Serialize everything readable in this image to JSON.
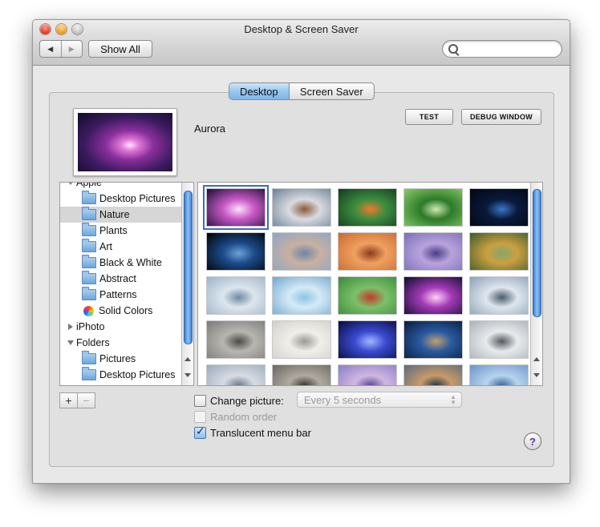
{
  "window": {
    "title": "Desktop & Screen Saver",
    "show_all_label": "Show All",
    "nav_back": "◀",
    "nav_forward": "▶",
    "search_placeholder": ""
  },
  "tabs": [
    {
      "label": "Desktop",
      "selected": true
    },
    {
      "label": "Screen Saver",
      "selected": false
    }
  ],
  "preview": {
    "picture_name": "Aurora",
    "test_label": "TEST",
    "debug_label": "DEBUG WINDOW"
  },
  "source_list": {
    "items": [
      {
        "label": "Apple",
        "kind": "group",
        "expanded": true
      },
      {
        "label": "Desktop Pictures",
        "kind": "folder"
      },
      {
        "label": "Nature",
        "kind": "folder",
        "selected": true
      },
      {
        "label": "Plants",
        "kind": "folder"
      },
      {
        "label": "Art",
        "kind": "folder"
      },
      {
        "label": "Black & White",
        "kind": "folder"
      },
      {
        "label": "Abstract",
        "kind": "folder"
      },
      {
        "label": "Patterns",
        "kind": "folder"
      },
      {
        "label": "Solid Colors",
        "kind": "colors"
      },
      {
        "label": "iPhoto",
        "kind": "group",
        "expanded": false
      },
      {
        "label": "Folders",
        "kind": "group",
        "expanded": true
      },
      {
        "label": "Pictures",
        "kind": "folder"
      },
      {
        "label": "Desktop Pictures",
        "kind": "folder"
      }
    ],
    "add_label": "+",
    "remove_label": "−"
  },
  "thumbnails": [
    {
      "subject": "aurora purple",
      "selected": true,
      "colors": [
        "#1a0c33",
        "#c85ac6",
        "#ffe0ff"
      ]
    },
    {
      "subject": "mountain peaks",
      "colors": [
        "#6a7e96",
        "#d9dbe0",
        "#8b5a3a"
      ]
    },
    {
      "subject": "clownfish anemone",
      "colors": [
        "#123a1e",
        "#3d8d3f",
        "#f07a2a"
      ]
    },
    {
      "subject": "dew drop leaf",
      "colors": [
        "#8acb6a",
        "#2d7a2a",
        "#cfe9b0"
      ]
    },
    {
      "subject": "earth horizon",
      "colors": [
        "#020510",
        "#0a1a3c",
        "#3a78c8"
      ]
    },
    {
      "subject": "earth globe",
      "colors": [
        "#000000",
        "#1c4c8c",
        "#6fa2d8"
      ]
    },
    {
      "subject": "misty sea",
      "colors": [
        "#8aa6c8",
        "#c8b0a0",
        "#6c86a8"
      ]
    },
    {
      "subject": "sandstone waves",
      "colors": [
        "#c76a2e",
        "#f0a060",
        "#8c3a1a"
      ]
    },
    {
      "subject": "purple dunes",
      "colors": [
        "#7a6cb8",
        "#b8a4dc",
        "#4a3c88"
      ]
    },
    {
      "subject": "golden pavilion",
      "colors": [
        "#3a5a2a",
        "#caa040",
        "#86a66a"
      ]
    },
    {
      "subject": "calm water",
      "colors": [
        "#9ab4c8",
        "#dde6ee",
        "#6f8aa0"
      ]
    },
    {
      "subject": "ice crystals",
      "colors": [
        "#6fa8d0",
        "#d6eaf6",
        "#8cc4e6"
      ]
    },
    {
      "subject": "ladybug leaf",
      "colors": [
        "#3a8a3a",
        "#7cc06a",
        "#c43a2a"
      ]
    },
    {
      "subject": "aurora",
      "colors": [
        "#0a0c2a",
        "#a43ab8",
        "#ffd0f6"
      ]
    },
    {
      "subject": "misty trees",
      "colors": [
        "#8aa0b8",
        "#dfe6ee",
        "#4a5a6c"
      ]
    },
    {
      "subject": "zen garden",
      "colors": [
        "#7a7a78",
        "#b8b6b0",
        "#4a4a48"
      ]
    },
    {
      "subject": "pebbles",
      "colors": [
        "#d0cfcb",
        "#f0efe9",
        "#9a9994"
      ]
    },
    {
      "subject": "blue aurora",
      "colors": [
        "#050a3a",
        "#3a4ad0",
        "#a0b8ff"
      ]
    },
    {
      "subject": "snow leopard rock",
      "colors": [
        "#0a1a3a",
        "#2a5aa0",
        "#c0a070"
      ]
    },
    {
      "subject": "snow leopard",
      "colors": [
        "#a8b0b8",
        "#e8eaec",
        "#555a60"
      ]
    },
    {
      "subject": "sand ripples",
      "colors": [
        "#9aaabb",
        "#d8dce4",
        "#6c7a8c"
      ]
    },
    {
      "subject": "beach stones",
      "colors": [
        "#6a6660",
        "#b0aaa0",
        "#3a3632"
      ]
    },
    {
      "subject": "lavender field",
      "colors": [
        "#8a7cc8",
        "#d0b8e0",
        "#5a4a9a"
      ]
    },
    {
      "subject": "rocky shore",
      "colors": [
        "#5a6a7c",
        "#c89a6a",
        "#2a3646"
      ]
    },
    {
      "subject": "ocean",
      "colors": [
        "#6a94c8",
        "#b8d4ee",
        "#3a64a0"
      ]
    }
  ],
  "options": {
    "change_picture_label": "Change picture:",
    "change_picture_checked": false,
    "interval_value": "Every 5 seconds",
    "random_order_label": "Random order",
    "random_order_checked": false,
    "translucent_label": "Translucent menu bar",
    "translucent_checked": true
  },
  "help_label": "?"
}
